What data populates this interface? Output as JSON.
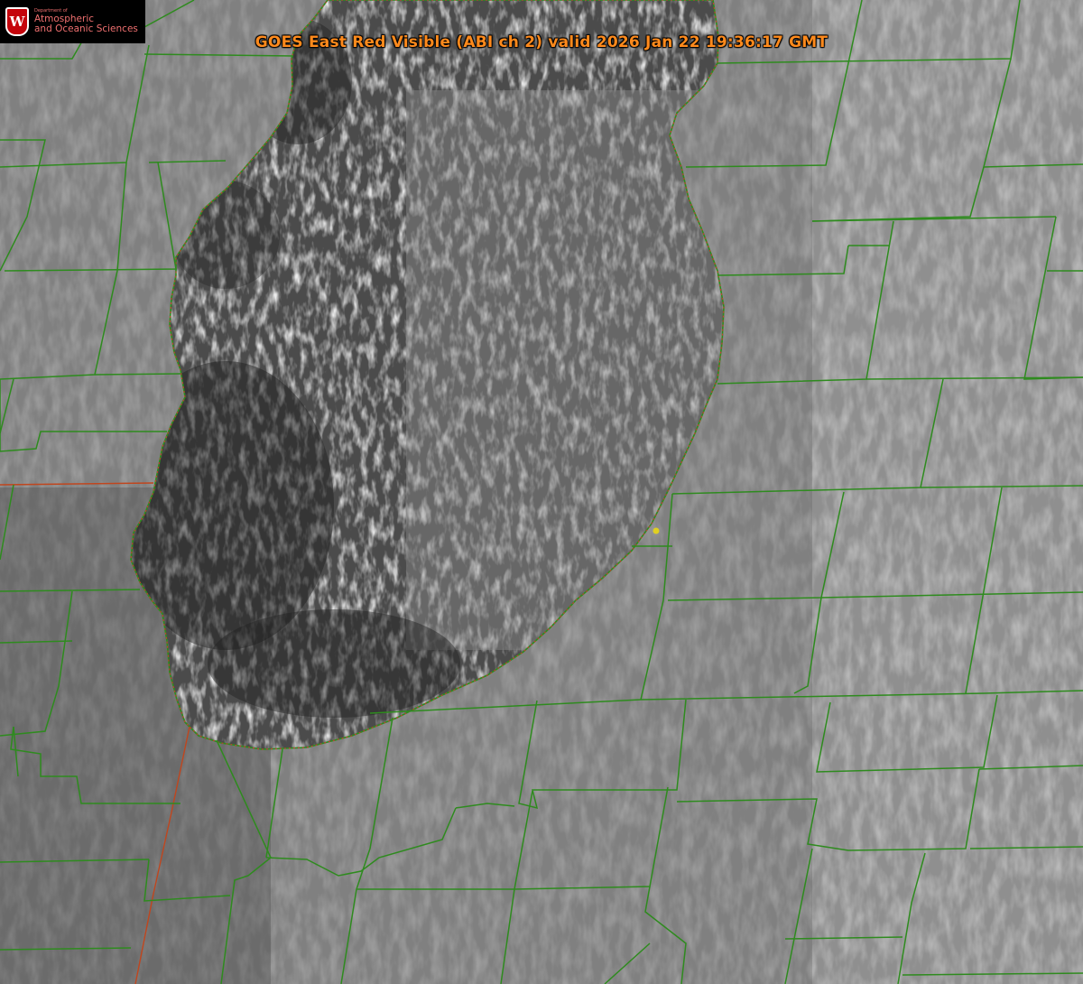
{
  "title": "GOES East Red Visible (ABI ch 2) valid 2026 Jan 22 19:36:17 GMT",
  "logo": {
    "badge_letter": "W",
    "department": "Department of",
    "line1": "Atmospheric",
    "line2": "and Oceanic Sciences"
  },
  "colors": {
    "county_lines": "#2e8b1e",
    "state_line": "#c0461e",
    "shoreline": "#e03030",
    "site_marker": "#e0d020",
    "title": "#ff8a1c",
    "logo_text": "#f07070",
    "logo_badge": "#c5050c"
  }
}
